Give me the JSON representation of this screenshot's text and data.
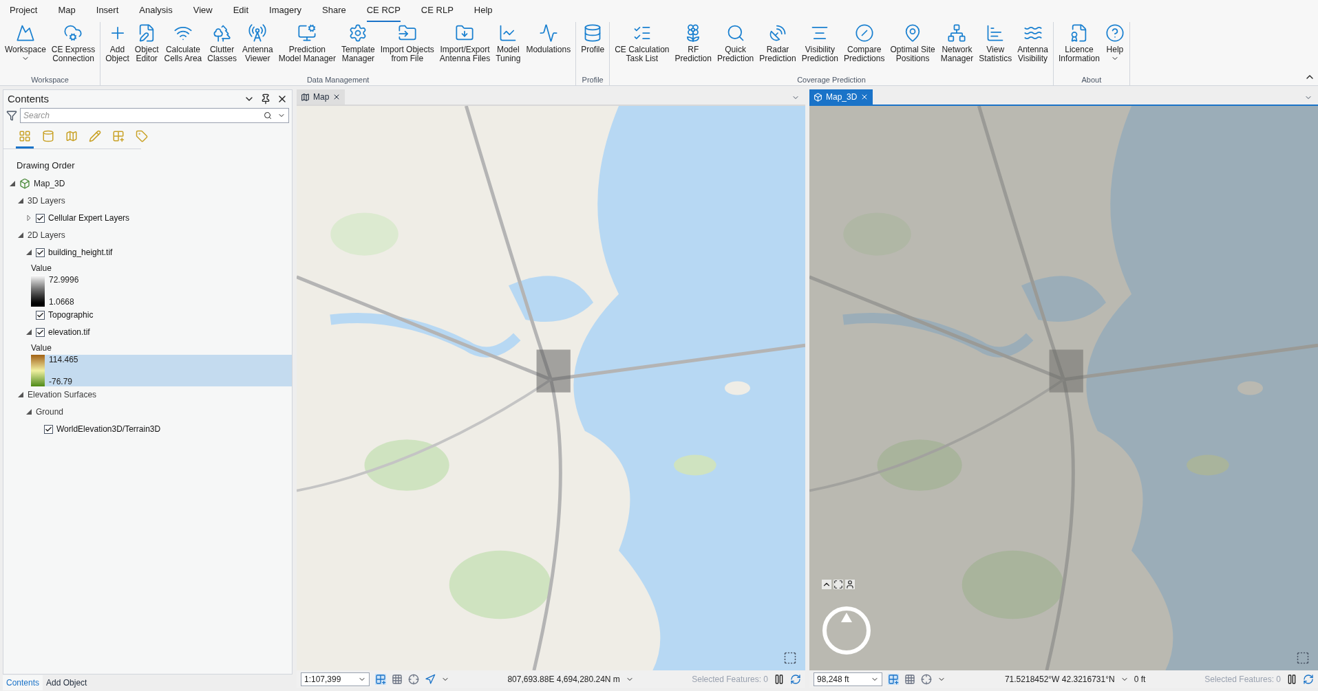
{
  "menu_tabs": [
    {
      "label": "Project",
      "selected": false
    },
    {
      "label": "Map",
      "selected": false
    },
    {
      "label": "Insert",
      "selected": false
    },
    {
      "label": "Analysis",
      "selected": false
    },
    {
      "label": "View",
      "selected": false
    },
    {
      "label": "Edit",
      "selected": false
    },
    {
      "label": "Imagery",
      "selected": false
    },
    {
      "label": "Share",
      "selected": false
    },
    {
      "label": "CE RCP",
      "selected": true
    },
    {
      "label": "CE RLP",
      "selected": false
    },
    {
      "label": "Help",
      "selected": false
    }
  ],
  "ribbon_groups": [
    {
      "title": "Workspace",
      "buttons": [
        {
          "label": "Workspace",
          "dropdown": true
        },
        {
          "label": "CE Express\nConnection",
          "dropdown": false
        }
      ]
    },
    {
      "title": "Data Management",
      "buttons": [
        {
          "label": "Add\nObject",
          "dropdown": false
        },
        {
          "label": "Object\nEditor",
          "dropdown": false
        },
        {
          "label": "Calculate\nCells Area",
          "dropdown": false
        },
        {
          "label": "Clutter\nClasses",
          "dropdown": false
        },
        {
          "label": "Antenna\nViewer",
          "dropdown": false
        },
        {
          "label": "Prediction\nModel Manager",
          "dropdown": false
        },
        {
          "label": "Template\nManager",
          "dropdown": false
        },
        {
          "label": "Import Objects\nfrom File",
          "dropdown": false
        },
        {
          "label": "Import/Export\nAntenna Files",
          "dropdown": false
        },
        {
          "label": "Model\nTuning",
          "dropdown": false
        },
        {
          "label": "Modulations",
          "dropdown": false
        }
      ]
    },
    {
      "title": "Profile",
      "buttons": [
        {
          "label": "Profile",
          "dropdown": false
        }
      ]
    },
    {
      "title": "Coverage Prediction",
      "buttons": [
        {
          "label": "CE Calculation\nTask List",
          "dropdown": false
        },
        {
          "label": "RF\nPrediction",
          "dropdown": false
        },
        {
          "label": "Quick\nPrediction",
          "dropdown": false
        },
        {
          "label": "Radar\nPrediction",
          "dropdown": false
        },
        {
          "label": "Visibility\nPrediction",
          "dropdown": false
        },
        {
          "label": "Compare\nPredictions",
          "dropdown": false
        },
        {
          "label": "Optimal Site\nPositions",
          "dropdown": false
        },
        {
          "label": "Network\nManager",
          "dropdown": false
        },
        {
          "label": "View\nStatistics",
          "dropdown": false
        },
        {
          "label": "Antenna\nVisibility",
          "dropdown": false
        }
      ]
    },
    {
      "title": "About",
      "buttons": [
        {
          "label": "Licence\nInformation",
          "dropdown": false
        },
        {
          "label": "Help",
          "dropdown": true
        }
      ]
    }
  ],
  "contents": {
    "title": "Contents",
    "search": {
      "placeholder": "Search"
    },
    "view_tabs": [
      {
        "selected": true
      },
      {
        "selected": false
      },
      {
        "selected": false
      },
      {
        "selected": false
      },
      {
        "selected": false
      },
      {
        "selected": false
      }
    ],
    "heading": "Drawing Order",
    "tree": [
      {
        "label": "Map_3D",
        "kind": "map",
        "expanded": true,
        "children": [
          {
            "label": "3D Layers",
            "kind": "group",
            "expanded": true,
            "children": [
              {
                "label": "Cellular Expert Layers",
                "kind": "layer",
                "checked": true,
                "expanded": false
              }
            ]
          },
          {
            "label": "2D Layers",
            "kind": "group",
            "expanded": true,
            "children": [
              {
                "label": "building_height.tif",
                "kind": "layer",
                "checked": true,
                "expanded": true,
                "legend": {
                  "heading": "Value",
                  "high": "72.9996",
                  "low": "1.0668",
                  "kind": "gray",
                  "selected": false
                }
              },
              {
                "label": "Topographic",
                "kind": "layer",
                "checked": true
              },
              {
                "label": "elevation.tif",
                "kind": "layer",
                "checked": true,
                "expanded": true,
                "legend": {
                  "heading": "Value",
                  "high": "114.465",
                  "low": "-76.79",
                  "kind": "terrain",
                  "selected": true
                }
              }
            ]
          },
          {
            "label": "Elevation Surfaces",
            "kind": "group",
            "expanded": true,
            "children": [
              {
                "label": "Ground",
                "kind": "group",
                "expanded": true,
                "children": [
                  {
                    "label": "WorldElevation3D/Terrain3D",
                    "kind": "layer",
                    "checked": true
                  }
                ]
              }
            ]
          }
        ]
      }
    ],
    "bottom_tabs": [
      {
        "label": "Contents",
        "selected": true
      },
      {
        "label": "Add Object",
        "selected": false
      }
    ]
  },
  "map_views": [
    {
      "tab": "Map",
      "kind": "map",
      "active": false,
      "scale": "1:107,399",
      "coordinates": "807,693.88E 4,694,280.24N m",
      "selected_features": "Selected Features: 0"
    },
    {
      "tab": "Map_3D",
      "kind": "scene",
      "active": true,
      "scale": "98,248 ft",
      "coordinates": "71.5218452°W 42.3216731°N",
      "elevation": "0 ft",
      "selected_features": "Selected Features: 0"
    }
  ]
}
